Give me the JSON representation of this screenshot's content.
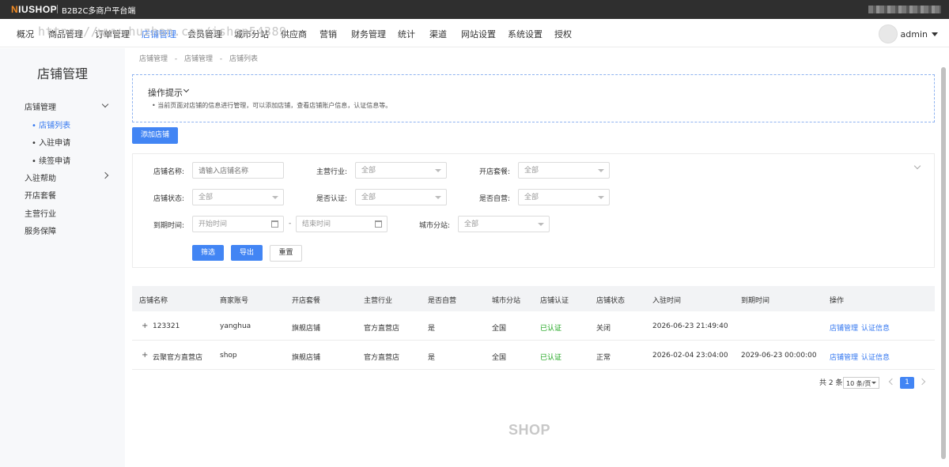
{
  "topbar": {
    "logo_highlight": "N",
    "logo_rest": "IUSHOP",
    "platform_name": "B2B2C多商户平台端"
  },
  "nav": {
    "items": [
      "概况",
      "商品管理",
      "订单管理",
      "店铺管理",
      "会员管理",
      "城市分站",
      "供应商",
      "营销",
      "财务管理",
      "统计",
      "渠道",
      "网站设置",
      "系统设置",
      "授权"
    ],
    "active": "店铺管理"
  },
  "watermark": "https://www.huzhan.com/ishop54389",
  "user": {
    "name": "admin"
  },
  "sidebar": {
    "title": "店铺管理",
    "groups": [
      {
        "label": "店铺管理",
        "expanded": true,
        "children": [
          "店铺列表",
          "入驻申请",
          "续签申请"
        ],
        "active_child": "店铺列表"
      },
      {
        "label": "入驻帮助",
        "expanded": false
      },
      {
        "label": "开店套餐"
      },
      {
        "label": "主营行业"
      },
      {
        "label": "服务保障"
      }
    ]
  },
  "breadcrumb": [
    "店铺管理",
    "-",
    "店铺管理",
    "-",
    "店铺列表"
  ],
  "tips": {
    "title": "操作提示",
    "text": "当前页面对店铺的信息进行管理，可以添加店铺，查看店铺账户信息，认证信息等。"
  },
  "add_button": "添加店铺",
  "filters": {
    "shop_name": {
      "label": "店铺名称:",
      "placeholder": "请输入店铺名称"
    },
    "industry": {
      "label": "主营行业:",
      "value": "全部"
    },
    "package": {
      "label": "开店套餐:",
      "value": "全部"
    },
    "status": {
      "label": "店铺状态:",
      "value": "全部"
    },
    "certified": {
      "label": "是否认证:",
      "value": "全部"
    },
    "self_run": {
      "label": "是否自营:",
      "value": "全部"
    },
    "expire": {
      "label": "到期时间:",
      "start": "开始时间",
      "end": "结束时间",
      "sep": "-"
    },
    "city": {
      "label": "城市分站:",
      "value": "全部"
    },
    "buttons": {
      "filter": "筛选",
      "export": "导出",
      "reset": "重置"
    }
  },
  "table": {
    "headers": [
      "店铺名称",
      "商家账号",
      "开店套餐",
      "主营行业",
      "是否自营",
      "城市分站",
      "店铺认证",
      "店铺状态",
      "入驻时间",
      "到期时间",
      "操作"
    ],
    "rows": [
      {
        "expand": "+",
        "name": "123321",
        "account": "yanghua",
        "package": "旗舰店铺",
        "industry": "官方直营店",
        "self_run": "是",
        "city": "全国",
        "cert": "已认证",
        "status": "关闭",
        "join_time": "2026-06-23 21:49:40",
        "expire_time": "",
        "action1": "店铺管理",
        "action2": "认证信息"
      },
      {
        "expand": "+",
        "name": "云聚官方直营店",
        "account": "shop",
        "package": "旗舰店铺",
        "industry": "官方直营店",
        "self_run": "是",
        "city": "全国",
        "cert": "已认证",
        "status": "正常",
        "join_time": "2026-02-04 23:04:00",
        "expire_time": "2029-06-23 00:00:00",
        "action1": "店铺管理",
        "action2": "认证信息"
      }
    ]
  },
  "pagination": {
    "total": "共 2 条",
    "page_size": "10 条/页",
    "current": "1"
  },
  "footer_logo": "SHOP",
  "colors": {
    "primary": "#4285f4",
    "success": "#19a319",
    "topbar": "#2f2f2f"
  }
}
